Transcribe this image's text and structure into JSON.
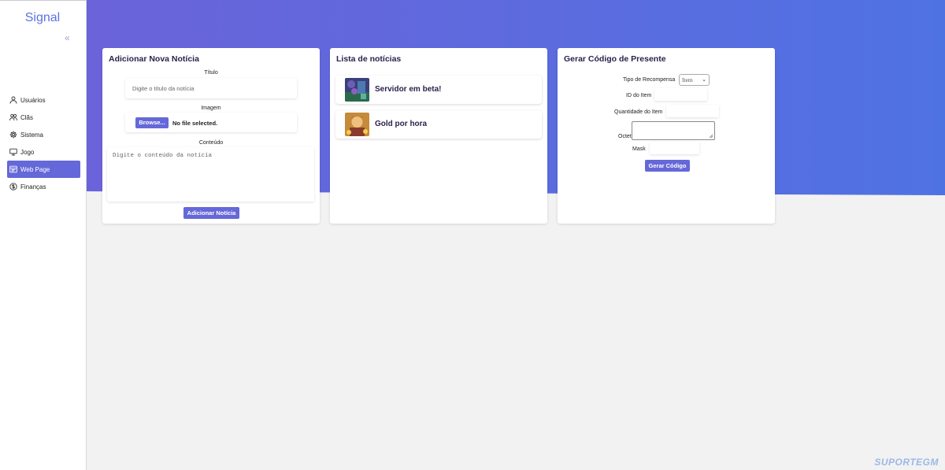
{
  "sidebar": {
    "brand": "Signal",
    "collapse_glyph": "«",
    "items": [
      {
        "label": "Usuários",
        "icon": "user-icon"
      },
      {
        "label": "Clãs",
        "icon": "users-icon"
      },
      {
        "label": "Sistema",
        "icon": "gear-icon"
      },
      {
        "label": "Jogo",
        "icon": "monitor-icon"
      },
      {
        "label": "Web Page",
        "icon": "webpage-icon",
        "active": true
      },
      {
        "label": "Finanças",
        "icon": "dollar-icon"
      }
    ]
  },
  "colors": {
    "accent": "#6568d8",
    "banner_start": "#6b63d9",
    "banner_end": "#4f72e3",
    "background": "#f2f2f2"
  },
  "add_news": {
    "title": "Adicionar Nova Notícia",
    "titulo_label": "Título",
    "titulo_placeholder": "Digite o título da notícia",
    "imagem_label": "Imagem",
    "browse_label": "Browse...",
    "file_status": "No file selected.",
    "conteudo_label": "Conteúdo",
    "conteudo_placeholder": "Digite o conteúdo da notícia",
    "submit_label": "Adicionar Notícia"
  },
  "news_list": {
    "title": "Lista de notícias",
    "items": [
      {
        "title": "Servidor em beta!"
      },
      {
        "title": "Gold por hora"
      }
    ]
  },
  "gift_code": {
    "title": "Gerar Código de Presente",
    "tipo_label": "Tipo de Recompensa",
    "tipo_value": "Item",
    "id_label": "ID do Item",
    "quantidade_label": "Quantidade do Item",
    "octet_label": "Octet",
    "mask_label": "Mask",
    "submit_label": "Gerar Código"
  },
  "watermark": "SUPORTEGM"
}
